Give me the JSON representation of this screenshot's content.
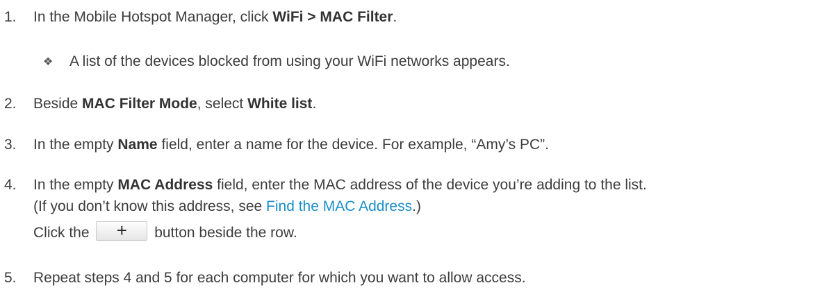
{
  "steps": [
    {
      "number": "1.",
      "pre": "In the Mobile Hotspot Manager, click ",
      "bold": "WiFi > MAC Filter",
      "post": "."
    },
    {
      "bullet_icon": "diamond-bullet-icon",
      "bullet_text": "A list of the devices blocked from using your WiFi networks appears."
    },
    {
      "number": "2.",
      "pre": "Beside ",
      "bold": "MAC Filter Mode",
      "mid": ", select ",
      "bold2": "White list",
      "post": "."
    },
    {
      "number": "3.",
      "pre": "In the empty ",
      "bold": "Name",
      "post": " field, enter a name for the device. For example, “Amy’s PC”."
    },
    {
      "number": "4.",
      "pre": "In the empty ",
      "bold": "MAC Address",
      "post": " field, enter the MAC address of the device you’re adding to the list.",
      "line2_pre": "(If you don’t know this address, see ",
      "line2_link": "Find the MAC Address",
      "line2_post": ".)",
      "line3_pre": "Click the ",
      "line3_button": "+",
      "line3_post": " button beside the row."
    },
    {
      "number": "5.",
      "text": "Repeat steps 4 and 5 for each computer for which you want to allow access."
    }
  ],
  "colors": {
    "text": "#3c3c3c",
    "link": "#1a8fc9"
  }
}
